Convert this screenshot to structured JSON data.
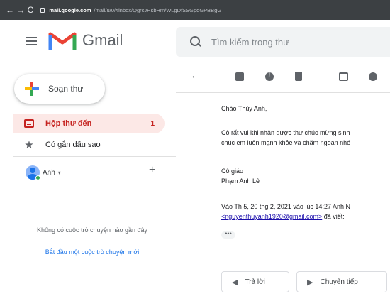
{
  "browser": {
    "nav_icons": "← → C",
    "url_host": "mail.google.com",
    "url_path": "/mail/u/0/#inbox/QgrcJHsbHm/WLgDfSSGpqGPBBgG"
  },
  "header": {
    "app_name": "Gmail",
    "search_placeholder": "Tìm kiếm trong thư"
  },
  "sidebar": {
    "compose_label": "Soạn thư",
    "items": [
      {
        "label": "Hộp thư đến",
        "count": "1",
        "icon": "inbox-icon"
      },
      {
        "label": "Có gắn dấu sao",
        "icon": "star-icon"
      }
    ],
    "hangouts_user": "Anh",
    "no_chat_text": "Không có cuộc trò chuyện nào gần đây",
    "start_chat_link": "Bắt đầu một cuộc trò chuyện mới"
  },
  "toolbar": {
    "icons": [
      "back-arrow-icon",
      "archive-icon",
      "report-spam-icon",
      "delete-icon",
      "move-to-icon",
      "snooze-icon"
    ]
  },
  "email": {
    "greeting": "Chào Thùy Anh,",
    "line1": "Cô rất vui khi nhận được thư chúc mừng sinh",
    "line2": "chúc em luôn mạnh khỏe và chăm ngoan nhé",
    "signature_1": "Cô giáo",
    "signature_2": "Phạm Anh Lê",
    "quote_1": "Vào Th 5, 20 thg 2, 2021 vào lúc 14:27 Anh N",
    "quote_link": "<nguyenthuyanh1920@gmail.com>",
    "quote_suffix": " đã viết:",
    "ellipsis": "•••"
  },
  "actions": {
    "reply_label": "Trả lời",
    "forward_label": "Chuyển tiếp"
  }
}
